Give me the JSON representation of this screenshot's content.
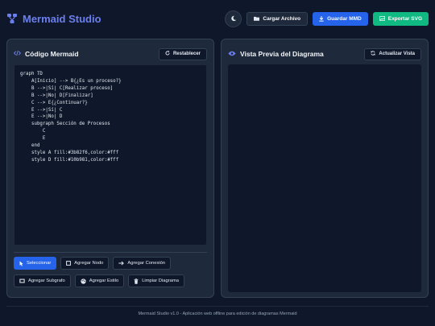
{
  "app": {
    "title": "Mermaid Studio"
  },
  "header": {
    "load_label": "Cargar Archivo",
    "save_label": "Guardar MMD",
    "export_label": "Exportar SVG"
  },
  "editor_panel": {
    "title": "Código Mermaid",
    "reset_label": "Restablecer",
    "code": [
      "graph TD",
      "    A[Inicio] --> B{¿Es un proceso?}",
      "    B -->|Sí| C[Realizar proceso]",
      "    B -->|No| D[Finalizar]",
      "    C --> E{¿Continuar?}",
      "    E -->|Sí| C",
      "    E -->|No| D",
      "    subgraph Sección de Procesos",
      "        C",
      "        E",
      "    end",
      "    style A fill:#3b82f6,color:#fff",
      "    style D fill:#10b981,color:#fff"
    ]
  },
  "tools": {
    "row1": [
      "Seleccionar",
      "Agregar Nodo",
      "Agregar Conexión"
    ],
    "row2": [
      "Agregar Subgrafo",
      "Agregar Estilo",
      "Limpiar Diagrama"
    ]
  },
  "preview_panel": {
    "title": "Vista Previa del Diagrama",
    "refresh_label": "Actualizar Vista"
  },
  "footer": {
    "text": "Mermaid Studio v1.0 - Aplicación web offline para edición de diagramas Mermaid"
  },
  "colors": {
    "accent": "#6b7ff0",
    "primary": "#2563eb",
    "success": "#10b981",
    "bg": "#0f172a",
    "panel": "#1e293b"
  }
}
